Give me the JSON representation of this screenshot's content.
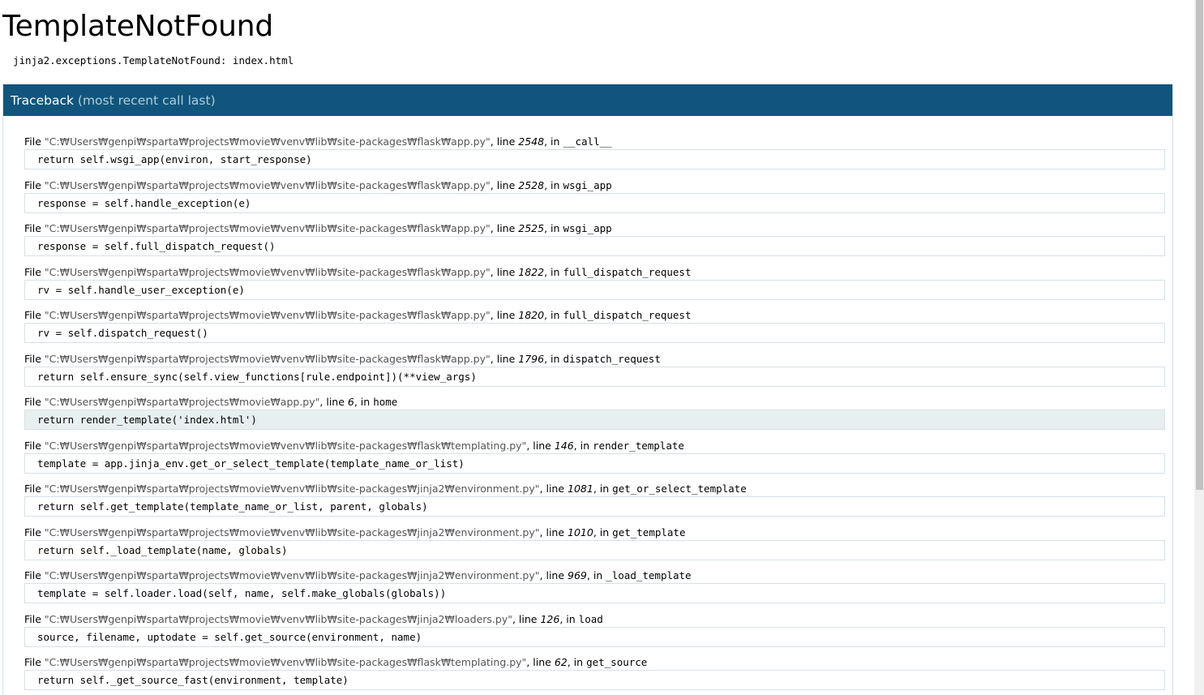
{
  "error": {
    "title": "TemplateNotFound",
    "message": "jinja2.exceptions.TemplateNotFound: index.html"
  },
  "traceback": {
    "header_label": "Traceback",
    "header_sub": "(most recent call last)",
    "file_word": "File",
    "line_word": "line",
    "in_word": "in",
    "frames": [
      {
        "filename": "\"C:₩Users₩genpi₩sparta₩projects₩movie₩venv₩lib₩site-packages₩flask₩app.py\"",
        "lineno": "2548",
        "func": "__call__",
        "code": "return self.wsgi_app(environ, start_response)",
        "current": false
      },
      {
        "filename": "\"C:₩Users₩genpi₩sparta₩projects₩movie₩venv₩lib₩site-packages₩flask₩app.py\"",
        "lineno": "2528",
        "func": "wsgi_app",
        "code": "response = self.handle_exception(e)",
        "current": false
      },
      {
        "filename": "\"C:₩Users₩genpi₩sparta₩projects₩movie₩venv₩lib₩site-packages₩flask₩app.py\"",
        "lineno": "2525",
        "func": "wsgi_app",
        "code": "response = self.full_dispatch_request()",
        "current": false
      },
      {
        "filename": "\"C:₩Users₩genpi₩sparta₩projects₩movie₩venv₩lib₩site-packages₩flask₩app.py\"",
        "lineno": "1822",
        "func": "full_dispatch_request",
        "code": "rv = self.handle_user_exception(e)",
        "current": false
      },
      {
        "filename": "\"C:₩Users₩genpi₩sparta₩projects₩movie₩venv₩lib₩site-packages₩flask₩app.py\"",
        "lineno": "1820",
        "func": "full_dispatch_request",
        "code": "rv = self.dispatch_request()",
        "current": false
      },
      {
        "filename": "\"C:₩Users₩genpi₩sparta₩projects₩movie₩venv₩lib₩site-packages₩flask₩app.py\"",
        "lineno": "1796",
        "func": "dispatch_request",
        "code": "return self.ensure_sync(self.view_functions[rule.endpoint])(**view_args)",
        "current": false
      },
      {
        "filename": "\"C:₩Users₩genpi₩sparta₩projects₩movie₩app.py\"",
        "lineno": "6",
        "func": "home",
        "code": "return render_template('index.html')",
        "current": true
      },
      {
        "filename": "\"C:₩Users₩genpi₩sparta₩projects₩movie₩venv₩lib₩site-packages₩flask₩templating.py\"",
        "lineno": "146",
        "func": "render_template",
        "code": "template = app.jinja_env.get_or_select_template(template_name_or_list)",
        "current": false
      },
      {
        "filename": "\"C:₩Users₩genpi₩sparta₩projects₩movie₩venv₩lib₩site-packages₩jinja2₩environment.py\"",
        "lineno": "1081",
        "func": "get_or_select_template",
        "code": "return self.get_template(template_name_or_list, parent, globals)",
        "current": false
      },
      {
        "filename": "\"C:₩Users₩genpi₩sparta₩projects₩movie₩venv₩lib₩site-packages₩jinja2₩environment.py\"",
        "lineno": "1010",
        "func": "get_template",
        "code": "return self._load_template(name, globals)",
        "current": false
      },
      {
        "filename": "\"C:₩Users₩genpi₩sparta₩projects₩movie₩venv₩lib₩site-packages₩jinja2₩environment.py\"",
        "lineno": "969",
        "func": "_load_template",
        "code": "template = self.loader.load(self, name, self.make_globals(globals))",
        "current": false
      },
      {
        "filename": "\"C:₩Users₩genpi₩sparta₩projects₩movie₩venv₩lib₩site-packages₩jinja2₩loaders.py\"",
        "lineno": "126",
        "func": "load",
        "code": "source, filename, uptodate = self.get_source(environment, name)",
        "current": false
      },
      {
        "filename": "\"C:₩Users₩genpi₩sparta₩projects₩movie₩venv₩lib₩site-packages₩flask₩templating.py\"",
        "lineno": "62",
        "func": "get_source",
        "code": "return self._get_source_fast(environment, template)",
        "current": false
      }
    ]
  },
  "colors": {
    "header_bg": "#11557c",
    "header_sub": "#b0cddb",
    "code_border": "#d6e1e8",
    "current_bg": "#e8eff0",
    "filename": "#555555"
  }
}
